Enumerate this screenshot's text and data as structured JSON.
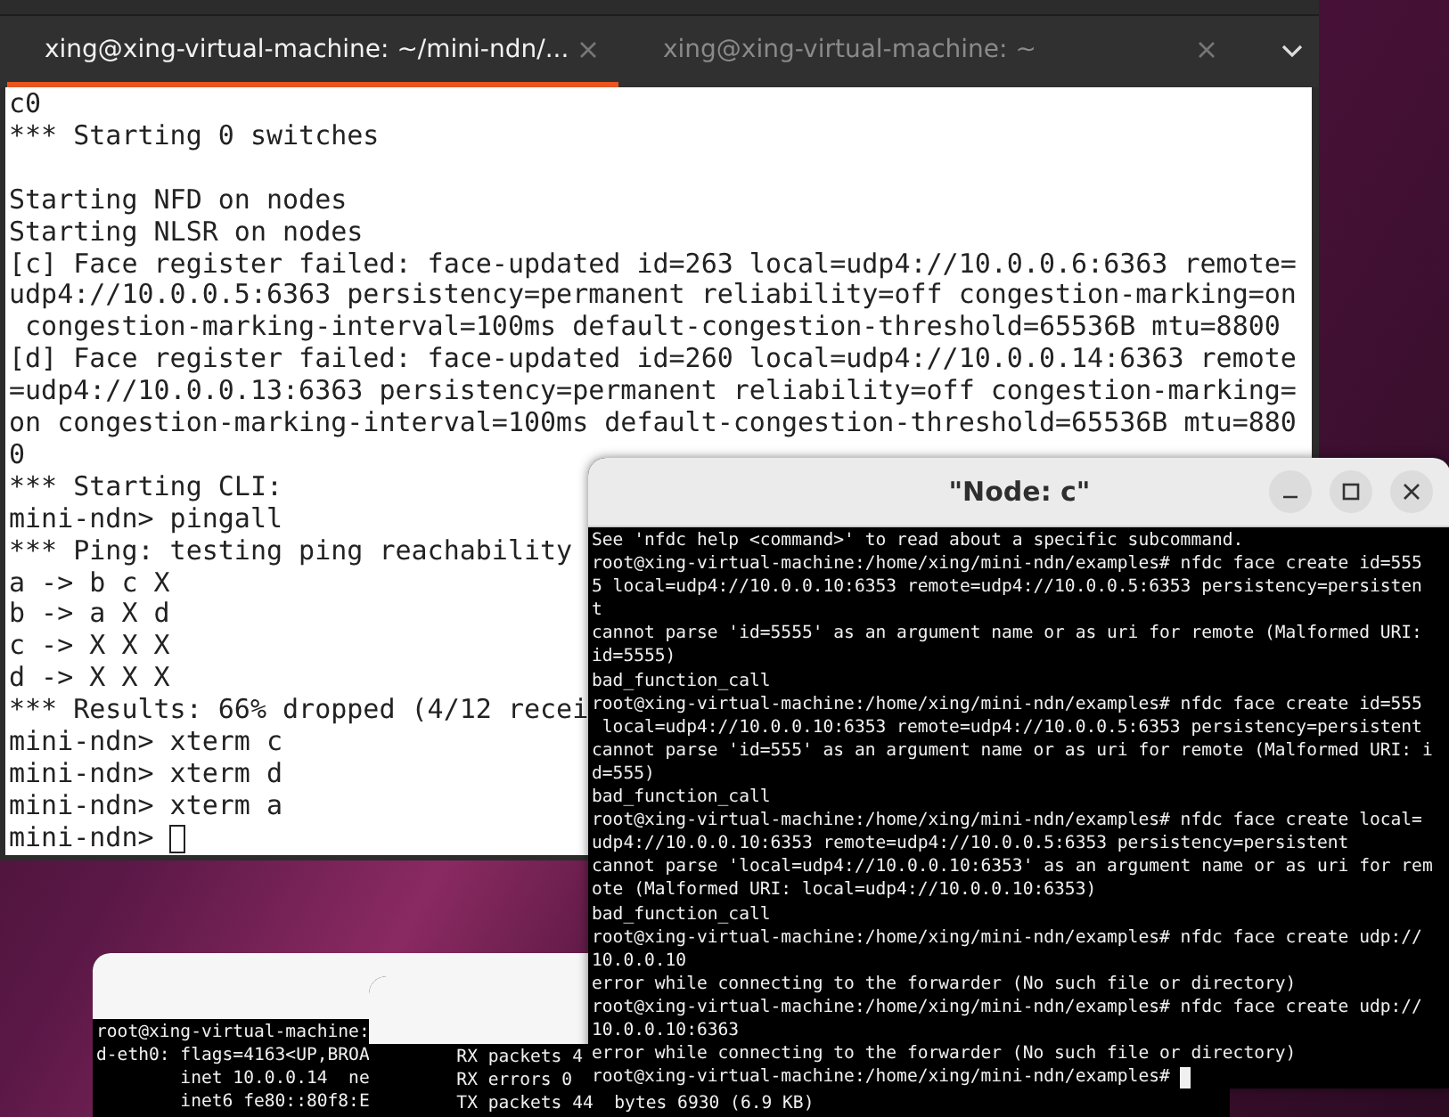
{
  "terminal": {
    "tabs": [
      {
        "label": "xing@xing-virtual-machine: ~/mini-ndn/...",
        "selected": true
      },
      {
        "label": "xing@xing-virtual-machine: ~",
        "selected": false
      }
    ],
    "blocks": [
      [
        "c0",
        "*** Starting 0 switches"
      ],
      [
        "Starting NFD on nodes",
        "Starting NLSR on nodes",
        "[c] Face register failed: face-updated id=263 local=udp4://10.0.0.6:6363 remote=",
        "udp4://10.0.0.5:6363 persistency=permanent reliability=off congestion-marking=on",
        " congestion-marking-interval=100ms default-congestion-threshold=65536B mtu=8800",
        "[d] Face register failed: face-updated id=260 local=udp4://10.0.0.14:6363 remote",
        "=udp4://10.0.0.13:6363 persistency=permanent reliability=off congestion-marking=",
        "on congestion-marking-interval=100ms default-congestion-threshold=65536B mtu=880",
        "0",
        "*** Starting CLI:",
        "mini-ndn> pingall",
        "*** Ping: testing ping reachability",
        "a -> b c X",
        "b -> a X d",
        "c -> X X X",
        "d -> X X X",
        "*** Results: 66% dropped (4/12 recei",
        "mini-ndn> xterm c",
        "mini-ndn> xterm d",
        "mini-ndn> xterm a",
        "mini-ndn>"
      ]
    ]
  },
  "back_terminals": [
    {
      "lines": [
        "root@xing-virtual-machine:",
        "d-eth0: flags=4163<UP,BROA",
        "        inet 10.0.0.14  ne",
        "        inet6 fe80::80f8:E"
      ]
    },
    {
      "lines": [
        "        RX packets 4",
        "        RX errors 0",
        "        TX packets 44  bytes 6930 (6.9 KB)"
      ]
    }
  ],
  "xterm": {
    "title": "\"Node: c\"",
    "lines": [
      "See 'nfdc help <command>' to read about a specific subcommand.",
      "root@xing-virtual-machine:/home/xing/mini-ndn/examples# nfdc face create id=555",
      "5 local=udp4://10.0.0.10:6353 remote=udp4://10.0.0.5:6353 persistency=persisten",
      "t",
      "cannot parse 'id=5555' as an argument name or as uri for remote (Malformed URI:",
      "id=5555)",
      "bad_function_call",
      "root@xing-virtual-machine:/home/xing/mini-ndn/examples# nfdc face create id=555",
      " local=udp4://10.0.0.10:6353 remote=udp4://10.0.0.5:6353 persistency=persistent",
      "cannot parse 'id=555' as an argument name or as uri for remote (Malformed URI: i",
      "d=555)",
      "bad_function_call",
      "root@xing-virtual-machine:/home/xing/mini-ndn/examples# nfdc face create local=",
      "udp4://10.0.0.10:6353 remote=udp4://10.0.0.5:6353 persistency=persistent",
      "cannot parse 'local=udp4://10.0.0.10:6353' as an argument name or as uri for rem",
      "ote (Malformed URI: local=udp4://10.0.0.10:6353)",
      "bad_function_call",
      "root@xing-virtual-machine:/home/xing/mini-ndn/examples# nfdc face create udp://",
      "10.0.0.10",
      "error while connecting to the forwarder (No such file or directory)",
      "root@xing-virtual-machine:/home/xing/mini-ndn/examples# nfdc face create udp://",
      "10.0.0.10:6363",
      "error while connecting to the forwarder (No such file or directory)",
      "root@xing-virtual-machine:/home/xing/mini-ndn/examples#"
    ]
  }
}
